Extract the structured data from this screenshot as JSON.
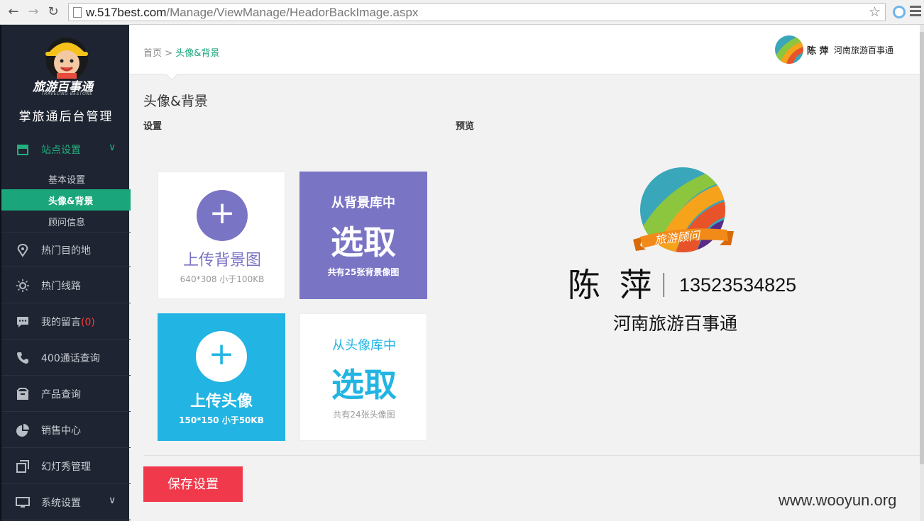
{
  "browser": {
    "url_host": "w.517best.com",
    "url_path": "/Manage/ViewManage/HeadorBackImage.aspx"
  },
  "sidebar": {
    "logo_text": "旅游百事通",
    "logo_sub": "TRAVELING BESTONE",
    "admin_title": "掌旅通后台管理",
    "groups": [
      {
        "label": "站点设置",
        "icon": "store-icon"
      },
      {
        "label": "热门目的地",
        "icon": "location-pin-icon"
      },
      {
        "label": "热门线路",
        "icon": "sun-icon"
      },
      {
        "label": "我的留言",
        "badge": "(0)",
        "icon": "chat-icon"
      },
      {
        "label": "400通话查询",
        "icon": "phone-icon"
      },
      {
        "label": "产品查询",
        "icon": "box-icon"
      },
      {
        "label": "销售中心",
        "icon": "pie-chart-icon"
      },
      {
        "label": "幻灯秀管理",
        "icon": "slides-icon"
      },
      {
        "label": "系统设置",
        "icon": "monitor-icon"
      }
    ],
    "sub_items": [
      {
        "label": "基本设置"
      },
      {
        "label": "头像&背景"
      },
      {
        "label": "顾问信息"
      }
    ],
    "colors": {
      "bg": "#1e2431",
      "accent": "#1aa57a"
    }
  },
  "header": {
    "breadcrumb_home": "首页",
    "breadcrumb_sep": ">",
    "breadcrumb_current": "头像&背景",
    "user_name": "陈 萍",
    "user_org": "河南旅游百事通"
  },
  "main": {
    "title": "头像&背景",
    "settings_label": "设置",
    "preview_label": "预览",
    "cards": {
      "upload_bg": {
        "plus": "+",
        "title": "上传背景图",
        "sub": "640*308 小于100KB"
      },
      "pick_bg": {
        "top": "从背景库中",
        "big": "选取",
        "sub": "共有25张背景像图"
      },
      "upload_avatar": {
        "plus": "+",
        "title": "上传头像",
        "sub": "150*150 小于50KB"
      },
      "pick_avatar": {
        "top": "从头像库中",
        "big": "选取",
        "sub": "共有24张头像图"
      }
    },
    "save_button": "保存设置",
    "colors": {
      "purple": "#7a74c4",
      "blue": "#22b4e2",
      "red": "#f0394b"
    }
  },
  "preview": {
    "ribbon": "旅游顾问",
    "name": "陈 萍",
    "phone": "13523534825",
    "org": "河南旅游百事通"
  },
  "watermark": "www.wooyun.org"
}
